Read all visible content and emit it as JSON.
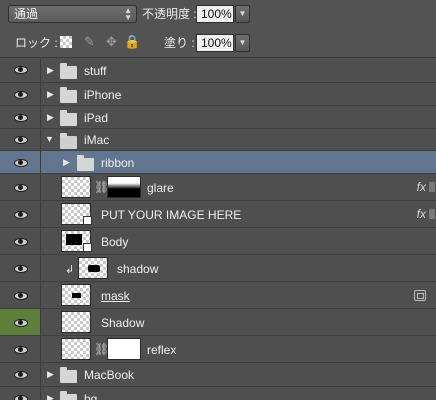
{
  "toolbar": {
    "blend_mode": "通過",
    "opacity_label": "不透明度 :",
    "opacity_value": "100%",
    "lock_label": "ロック :",
    "fill_label": "塗り :",
    "fill_value": "100%"
  },
  "layers": [
    {
      "name": "stuff",
      "kind": "group",
      "expanded": false
    },
    {
      "name": "iPhone",
      "kind": "group",
      "expanded": false
    },
    {
      "name": "iPad",
      "kind": "group",
      "expanded": false
    },
    {
      "name": "iMac",
      "kind": "group",
      "expanded": true
    },
    {
      "name": "ribbon",
      "kind": "group",
      "expanded": false,
      "selected": true
    },
    {
      "name": "glare",
      "kind": "layer-with-mask",
      "fx": "fx"
    },
    {
      "name": "PUT YOUR IMAGE HERE",
      "kind": "smart-object",
      "fx": "fx"
    },
    {
      "name": "Body",
      "kind": "smart-object"
    },
    {
      "name": "shadow",
      "kind": "clipped-layer"
    },
    {
      "name": "mask",
      "kind": "layer"
    },
    {
      "name": "Shadow",
      "kind": "layer"
    },
    {
      "name": "reflex",
      "kind": "layer-with-mask"
    },
    {
      "name": "MacBook",
      "kind": "group",
      "expanded": false
    },
    {
      "name": "bg",
      "kind": "group",
      "expanded": false
    }
  ],
  "colors": {
    "panel": "#4f4f4f",
    "selected_row": "#62778f",
    "active_eye_cell": "#5d7f3a"
  }
}
